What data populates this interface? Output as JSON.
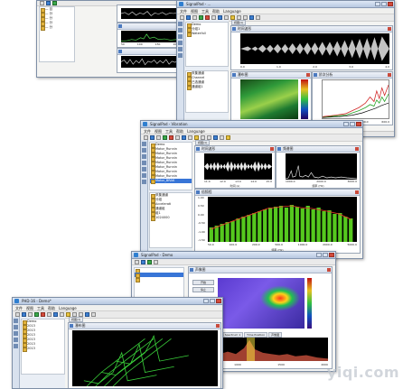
{
  "windows": {
    "win1": {
      "tree_items": [
        "— 目",
        "  — 分",
        "  — 分",
        "  — 分",
        "— 分"
      ],
      "plot_ticks": [
        "50",
        "100",
        "150",
        "200",
        "250"
      ]
    },
    "win2": {
      "title": "SignalPad - ...",
      "menu": [
        "文件",
        "视图",
        "工具",
        "帮助",
        "Language"
      ],
      "tab": "视图(1)",
      "tree_items": [
        "Demo",
        "分组1",
        "Waterfall"
      ],
      "tree2_items": [
        "采集通道",
        "Channel",
        "已选通道",
        "通道组1"
      ],
      "panels": {
        "time": {
          "title": "时间波形",
          "xlabel": "频率 (Hz)",
          "ticks": [
            "0.0",
            "1.0",
            "2.0",
            "3.0",
            "4.0"
          ]
        },
        "spec": {
          "title": "瀑布图",
          "ticks": [
            "1000.0",
            "2000.0"
          ]
        },
        "fft": {
          "title": "频谱",
          "ticks": [
            "2000",
            "4000",
            "6000"
          ]
        },
        "order": {
          "title": "阶次分析",
          "ticks": [
            "0.0",
            "200.0",
            "400.0",
            "600.0"
          ]
        }
      }
    },
    "win3": {
      "title": "SignalPad - Vibration",
      "menu": [
        "文件",
        "视图",
        "工具",
        "帮助",
        "Language"
      ],
      "tab": "视图(1)",
      "tree_items": [
        "Demo",
        "Motor_Runnin",
        "Motor_Runnin",
        "Motor_Runnin",
        "Motor_Runnin",
        "Motor_Runnin",
        "Motor_Runnin",
        "Motor_Runnin",
        "Motor_BRAK"
      ],
      "tree2_items": [
        "采集通道",
        "分组",
        "Accelerati",
        "通道组",
        "组1",
        "1024000"
      ],
      "panels": {
        "time": {
          "title": "时间波形",
          "ticks": [
            "11.0",
            "12.0",
            "13.0",
            "14.0",
            "15.0"
          ],
          "xlabel": "时间 (s)"
        },
        "spec": {
          "title": "频谱图",
          "ticks": [
            "1000.0",
            "2000.0",
            "3000.0"
          ],
          "xlabel": "频率 (Hz)"
        },
        "oct": {
          "title": "倍频程",
          "ylabel": "Acceleration (dB)",
          "xlabel": "频率 (Hz)",
          "yticks": [
            "1.00",
            "0.50",
            "0.00",
            "-0.50",
            "-1.00",
            "-1.50"
          ],
          "xticks": [
            "50.0",
            "100.0",
            "200.0",
            "500.0",
            "1000.0",
            "2000.0",
            "5000.0"
          ]
        }
      }
    },
    "win4": {
      "title": "SignalPad - Demo",
      "panel_title": "声像图",
      "tabs": [
        "通道1 (Seq1)",
        "通道 Spectrum 1",
        "Time Position",
        "声像图"
      ],
      "side_buttons": [
        "开始",
        "停止"
      ],
      "ticks": [
        "500",
        "1000",
        "1500",
        "2000"
      ]
    },
    "win5": {
      "title": "PHD-16 - Demo*",
      "menu": [
        "文件",
        "视图",
        "工具",
        "帮助",
        "Language"
      ],
      "tab": "视图(1)",
      "panel_title": "瀑布图",
      "tree_items": [
        "Demo",
        "2013",
        "2013",
        "2013",
        "2013",
        "2013",
        "2013"
      ]
    }
  },
  "watermark": "yiqi.com"
}
